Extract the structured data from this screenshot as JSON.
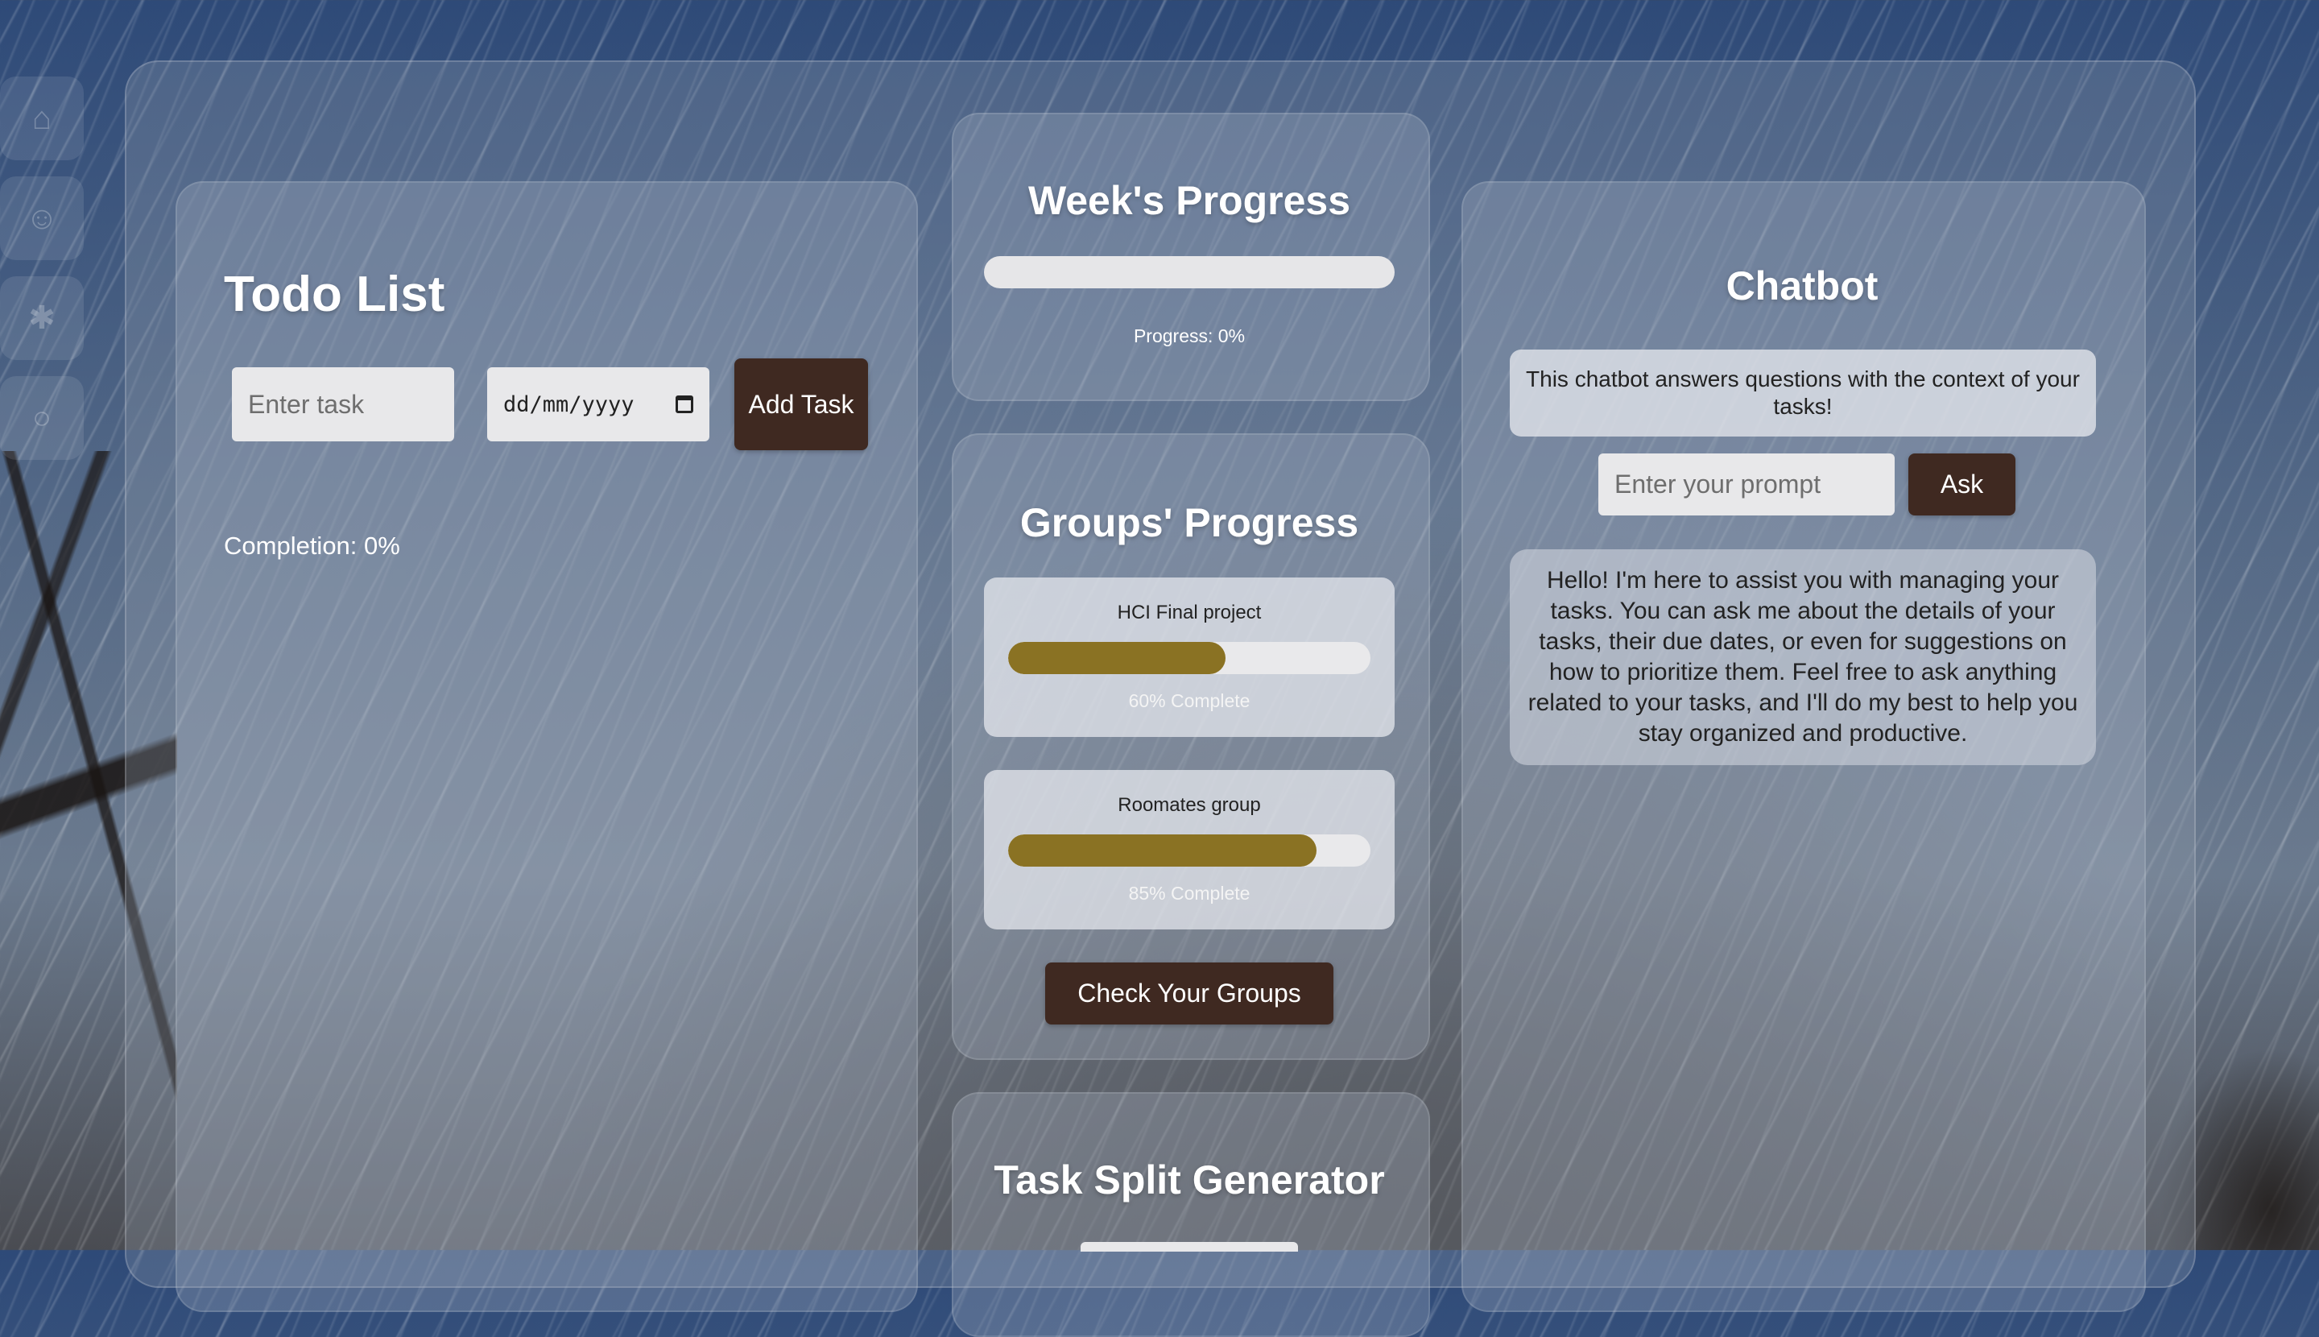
{
  "colors": {
    "accent_button": "#3f2921",
    "progress_fill": "#8a7223",
    "track": "#e6e6e8"
  },
  "side_rail": {
    "icons": [
      "home-icon",
      "profile-icon",
      "settings-icon",
      "search-icon"
    ]
  },
  "todo": {
    "title": "Todo List",
    "task_placeholder": "Enter task",
    "date_placeholder": "dd/mm/yyyy",
    "add_button": "Add Task",
    "completion_label": "Completion: 0%"
  },
  "week": {
    "title": "Week's Progress",
    "progress_value": 0,
    "progress_label": "Progress: 0%"
  },
  "groups": {
    "title": "Groups' Progress",
    "items": [
      {
        "name": "HCI Final project",
        "progress": 0.6,
        "label": "60% Complete"
      },
      {
        "name": "Roomates group",
        "progress": 0.85,
        "label": "85% Complete"
      }
    ],
    "check_button": "Check Your Groups"
  },
  "split": {
    "title": "Task Split Generator"
  },
  "chatbot": {
    "title": "Chatbot",
    "note": "This chatbot answers questions with the context of your tasks!",
    "prompt_placeholder": "Enter your prompt",
    "ask_button": "Ask",
    "reply": "Hello! I'm here to assist you with managing your tasks. You can ask me about the details of your tasks, their due dates, or even for suggestions on how to prioritize them. Feel free to ask anything related to your tasks, and I'll do my best to help you stay organized and productive."
  }
}
